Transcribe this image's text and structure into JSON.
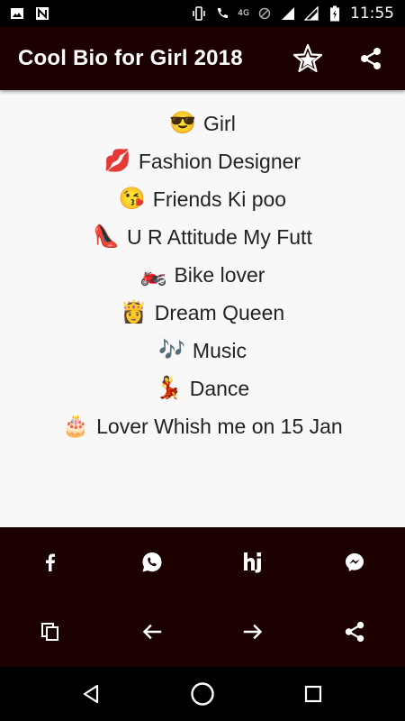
{
  "status_bar": {
    "network_label": "4G",
    "clock": "11:55"
  },
  "app_bar": {
    "title": "Cool Bio for Girl 2018",
    "actions": [
      "star-icon",
      "share-icon"
    ]
  },
  "bio_lines": [
    {
      "emoji": "😎",
      "text": "Girl"
    },
    {
      "emoji": "💋",
      "text": "Fashion Designer"
    },
    {
      "emoji": "😘",
      "text": "Friends Ki poo"
    },
    {
      "emoji": "👠",
      "text": "U R Attitude My Futt"
    },
    {
      "emoji": "🏍️",
      "text": "Bike lover"
    },
    {
      "emoji": "👸",
      "text": "Dream Queen"
    },
    {
      "emoji": "🎶",
      "text": "Music"
    },
    {
      "emoji": "💃",
      "text": "Dance"
    },
    {
      "emoji": "🎂",
      "text": "Lover Whish me on 15 Jan"
    }
  ],
  "share_bar": {
    "row1": [
      "facebook-icon",
      "whatsapp-icon",
      "hike-icon",
      "messenger-icon"
    ],
    "row2": [
      "copy-icon",
      "previous-arrow-icon",
      "next-arrow-icon",
      "share-icon"
    ]
  },
  "nav_bar": [
    "back-icon",
    "home-icon",
    "recents-icon"
  ],
  "colors": {
    "app_bar": "#1c0000",
    "content_bg": "#f8f8f8",
    "text": "#222222"
  }
}
